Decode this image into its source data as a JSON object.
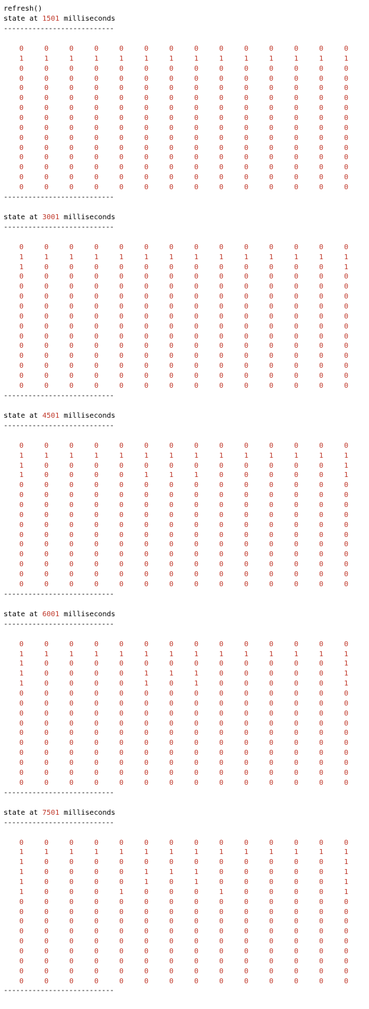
{
  "console": {
    "command": "refresh()",
    "separator": "---------------------------",
    "state_prefix": "state at ",
    "state_suffix": " milliseconds"
  },
  "states": [
    {
      "ms": "1501",
      "grid": [
        "00000000000000",
        "11111111111111",
        "00000000000000",
        "00000000000000",
        "00000000000000",
        "00000000000000",
        "00000000000000",
        "00000000000000",
        "00000000000000",
        "00000000000000",
        "00000000000000",
        "00000000000000",
        "00000000000000",
        "00000000000000",
        "00000000000000"
      ]
    },
    {
      "ms": "3001",
      "grid": [
        "00000000000000",
        "11111111111111",
        "10000000000001",
        "00000000000000",
        "00000000000000",
        "00000000000000",
        "00000000000000",
        "00000000000000",
        "00000000000000",
        "00000000000000",
        "00000000000000",
        "00000000000000",
        "00000000000000",
        "00000000000000",
        "00000000000000"
      ]
    },
    {
      "ms": "4501",
      "grid": [
        "00000000000000",
        "11111111111111",
        "10000000000001",
        "10000111000001",
        "00000000000000",
        "00000000000000",
        "00000000000000",
        "00000000000000",
        "00000000000000",
        "00000000000000",
        "00000000000000",
        "00000000000000",
        "00000000000000",
        "00000000000000",
        "00000000000000"
      ]
    },
    {
      "ms": "6001",
      "grid": [
        "00000000000000",
        "11111111111111",
        "10000000000001",
        "10000111000001",
        "10000101000001",
        "00000000000000",
        "00000000000000",
        "00000000000000",
        "00000000000000",
        "00000000000000",
        "00000000000000",
        "00000000000000",
        "00000000000000",
        "00000000000000",
        "00000000000000"
      ]
    },
    {
      "ms": "7501",
      "grid": [
        "00000000000000",
        "11111111111111",
        "10000000000001",
        "10000111000001",
        "10000101000001",
        "10001000100001",
        "00000000000000",
        "00000000000000",
        "00000000000000",
        "00000000000000",
        "00000000000000",
        "00000000000000",
        "00000000000000",
        "00000000000000",
        "00000000000000"
      ]
    }
  ],
  "colors": {
    "text": "#000000",
    "value": "#c0392b",
    "background": "#ffffff"
  }
}
